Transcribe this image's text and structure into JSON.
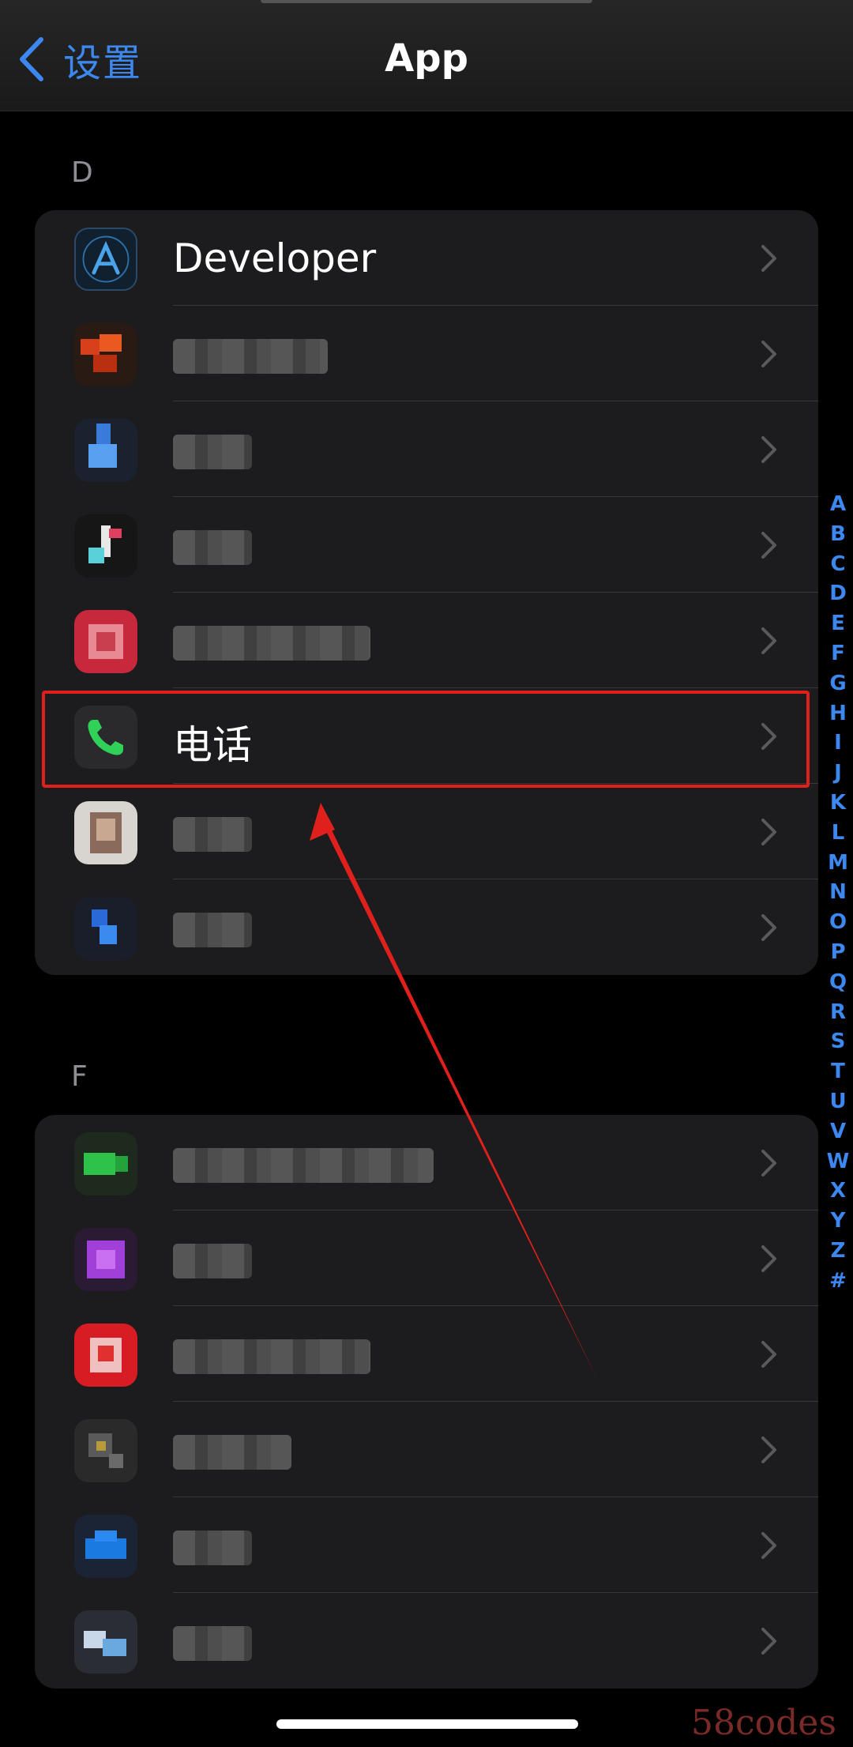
{
  "nav": {
    "back_label": "设置",
    "title": "App"
  },
  "sections": [
    {
      "letter": "D",
      "items": [
        {
          "label": "Developer",
          "icon": "developer-icon",
          "blurred": false
        },
        {
          "label": "",
          "icon": "app-icon-blurred-orange",
          "blurred": true
        },
        {
          "label": "",
          "icon": "app-icon-blurred-blue",
          "blurred": true
        },
        {
          "label": "",
          "icon": "app-icon-blurred-tiktok",
          "blurred": true
        },
        {
          "label": "",
          "icon": "app-icon-blurred-red",
          "blurred": true
        },
        {
          "label": "电话",
          "icon": "phone-icon",
          "blurred": false
        },
        {
          "label": "",
          "icon": "app-icon-blurred-portrait",
          "blurred": true
        },
        {
          "label": "",
          "icon": "app-icon-blurred-dingtalk",
          "blurred": true
        }
      ]
    },
    {
      "letter": "F",
      "items": [
        {
          "label": "",
          "icon": "facetime-icon",
          "blurred": true
        },
        {
          "label": "",
          "icon": "app-icon-blurred-purple",
          "blurred": true
        },
        {
          "label": "",
          "icon": "app-icon-blurred-red2",
          "blurred": true
        },
        {
          "label": "",
          "icon": "app-icon-blurred-magnifier",
          "blurred": true
        },
        {
          "label": "",
          "icon": "app-icon-blurred-blue2",
          "blurred": true
        },
        {
          "label": "",
          "icon": "app-icon-blurred-lightblue",
          "blurred": true
        }
      ]
    }
  ],
  "index_letters": [
    "A",
    "B",
    "C",
    "D",
    "E",
    "F",
    "G",
    "H",
    "I",
    "J",
    "K",
    "L",
    "M",
    "N",
    "O",
    "P",
    "Q",
    "R",
    "S",
    "T",
    "U",
    "V",
    "W",
    "X",
    "Y",
    "Z",
    "#"
  ],
  "watermark": "58codes",
  "colors": {
    "accent": "#3c88f0",
    "highlight": "#e0201c",
    "background": "#000000",
    "group_background": "#1c1c1e"
  }
}
